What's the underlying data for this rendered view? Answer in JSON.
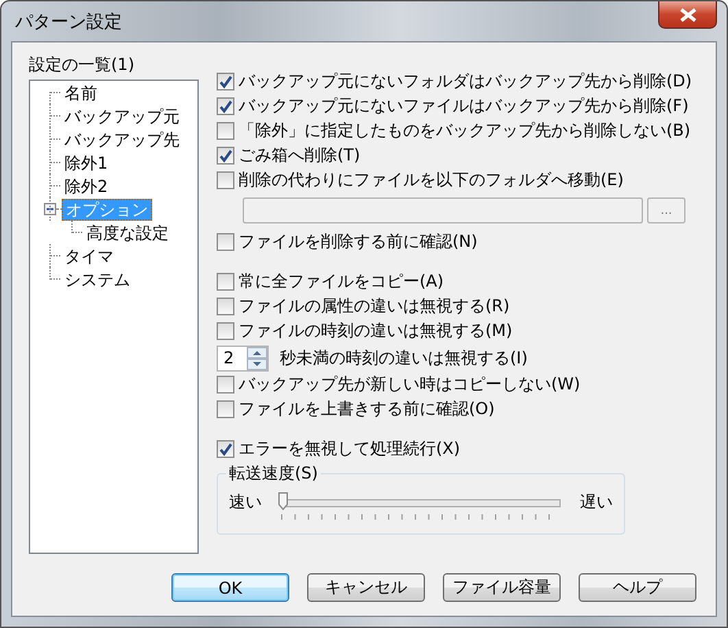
{
  "window": {
    "title": "パターン設定"
  },
  "settings_list": {
    "label": "設定の一覧(1)",
    "items": [
      {
        "label": "名前",
        "selected": false
      },
      {
        "label": "バックアップ元",
        "selected": false
      },
      {
        "label": "バックアップ先",
        "selected": false
      },
      {
        "label": "除外1",
        "selected": false
      },
      {
        "label": "除外2",
        "selected": false
      },
      {
        "label": "オプション",
        "selected": true,
        "expanded": true,
        "children": [
          {
            "label": "高度な設定",
            "selected": false
          }
        ]
      },
      {
        "label": "タイマ",
        "selected": false
      },
      {
        "label": "システム",
        "selected": false
      }
    ]
  },
  "sections": [
    {
      "items": [
        {
          "kind": "checkbox",
          "label": "バックアップ元にないフォルダはバックアップ先から削除(D)",
          "checked": true
        },
        {
          "kind": "checkbox",
          "label": "バックアップ元にないファイルはバックアップ先から削除(F)",
          "checked": true
        },
        {
          "kind": "checkbox",
          "label": "「除外」に指定したものをバックアップ先から削除しない(B)",
          "checked": false
        },
        {
          "kind": "checkbox",
          "label": "ごみ箱へ削除(T)",
          "checked": true
        },
        {
          "kind": "checkbox",
          "label": "削除の代わりにファイルを以下のフォルダへ移動(E)",
          "checked": false
        },
        {
          "kind": "path",
          "browse": "...",
          "disabled": true
        },
        {
          "kind": "checkbox",
          "label": "ファイルを削除する前に確認(N)",
          "checked": false
        }
      ]
    },
    {
      "items": [
        {
          "kind": "checkbox",
          "label": "常に全ファイルをコピー(A)",
          "checked": false
        },
        {
          "kind": "checkbox",
          "label": "ファイルの属性の違いは無視する(R)",
          "checked": false
        },
        {
          "kind": "checkbox",
          "label": "ファイルの時刻の違いは無視する(M)",
          "checked": false
        },
        {
          "kind": "spin",
          "field": {
            "value": "2"
          },
          "label": "秒未満の時刻の違いは無視する(I)"
        },
        {
          "kind": "checkbox",
          "label": "バックアップ先が新しい時はコピーしない(W)",
          "checked": false
        },
        {
          "kind": "checkbox",
          "label": "ファイルを上書きする前に確認(O)",
          "checked": false
        }
      ]
    },
    {
      "items": [
        {
          "kind": "checkbox",
          "label": "エラーを無視して処理続行(X)",
          "checked": true
        },
        {
          "kind": "slider",
          "title": "転送速度(S)",
          "min_label": "速い",
          "max_label": "遅い",
          "level": 0
        }
      ]
    }
  ],
  "buttons": [
    {
      "label": "OK",
      "default": true
    },
    {
      "label": "キャンセル",
      "default": false
    },
    {
      "label": "ファイル容量",
      "default": false
    },
    {
      "label": "ヘルプ",
      "default": false
    }
  ]
}
